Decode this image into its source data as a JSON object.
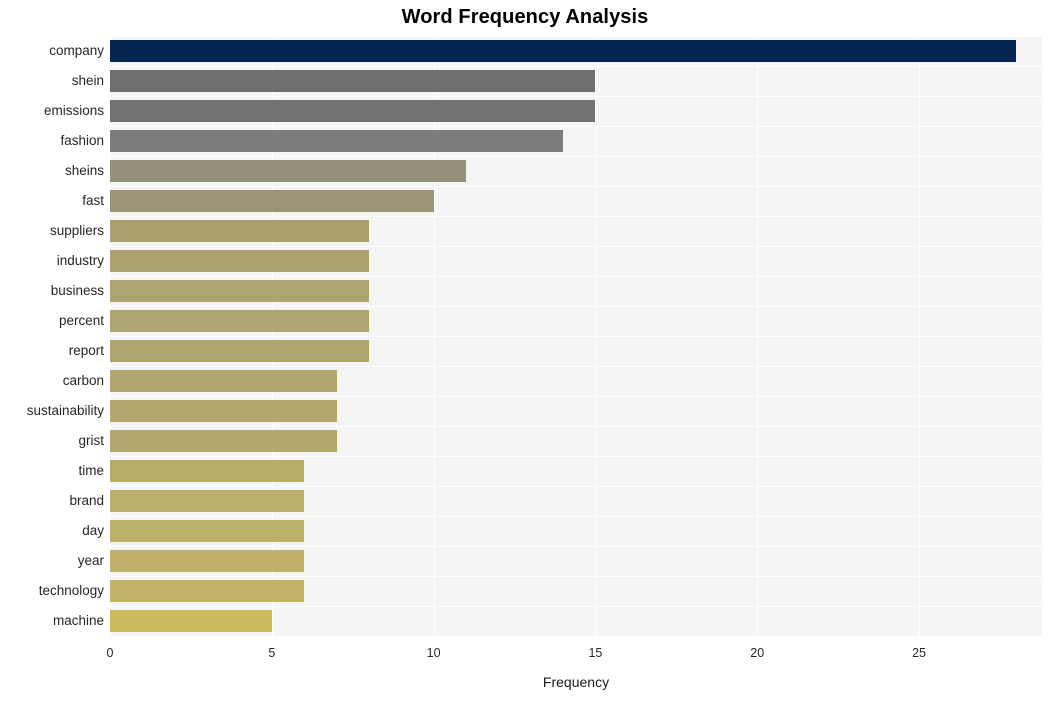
{
  "chart_data": {
    "type": "bar",
    "orientation": "horizontal",
    "title": "Word Frequency Analysis",
    "xlabel": "Frequency",
    "ylabel": "",
    "xlim": [
      0,
      28.8
    ],
    "ylim": [
      0,
      20
    ],
    "xticks": [
      0,
      5,
      10,
      15,
      20,
      25
    ],
    "xticklabels": [
      "0",
      "5",
      "10",
      "15",
      "20",
      "25"
    ],
    "grid": true,
    "legend": false,
    "categories": [
      "company",
      "shein",
      "emissions",
      "fashion",
      "sheins",
      "fast",
      "suppliers",
      "industry",
      "business",
      "percent",
      "report",
      "carbon",
      "sustainability",
      "grist",
      "time",
      "brand",
      "day",
      "year",
      "technology",
      "machine"
    ],
    "values": [
      28,
      15,
      15,
      14,
      11,
      10,
      8,
      8,
      8,
      8,
      8,
      7,
      7,
      7,
      6,
      6,
      6,
      6,
      6,
      5
    ],
    "bar_colors": [
      "#04254f",
      "#6e6e6e",
      "#737373",
      "#7c7c7c",
      "#95907a",
      "#9c9476",
      "#ab9f6f",
      "#ada170",
      "#afa370",
      "#b0a470",
      "#b1a56f",
      "#b2a66f",
      "#b3a76e",
      "#b4a86e",
      "#b9ac6b",
      "#bbae6a",
      "#bdb069",
      "#bfb268",
      "#c1b466",
      "#cbbd5e"
    ]
  },
  "style": {
    "plot_background": "#f5f5f5",
    "grid_color": "#ffffff",
    "page_background": "#ffffff",
    "title_color": "#000000",
    "tick_color": "#262626"
  }
}
